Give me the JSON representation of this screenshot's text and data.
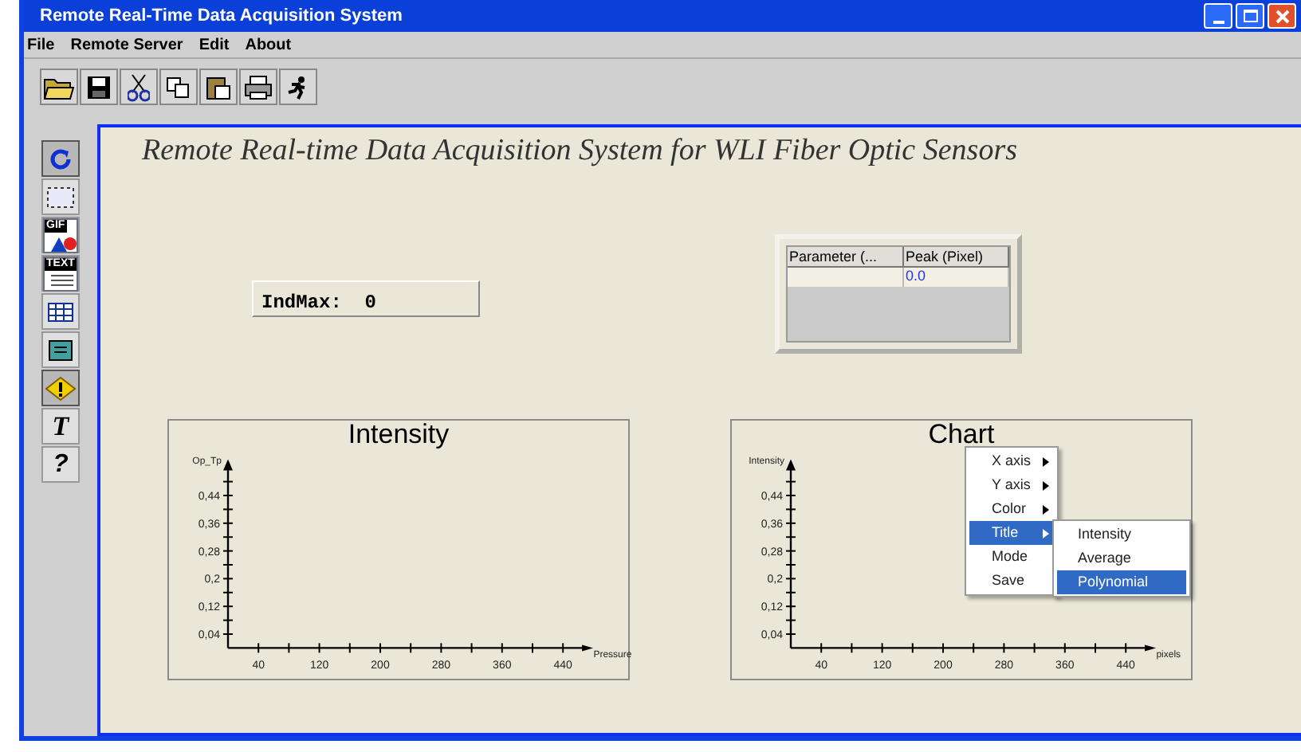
{
  "window": {
    "title": "Remote Real-Time Data Acquisition System"
  },
  "menu": [
    "File",
    "Remote Server",
    "Edit",
    "About"
  ],
  "toolbar": [
    {
      "kind": "open"
    },
    {
      "kind": "save"
    },
    {
      "kind": "cut"
    },
    {
      "kind": "copy"
    },
    {
      "kind": "paste"
    },
    {
      "kind": "print"
    },
    {
      "kind": "run"
    }
  ],
  "tools": [
    {
      "kind": "refresh",
      "selected": true
    },
    {
      "kind": "select",
      "selected": false
    },
    {
      "kind": "gif",
      "label": "GIF",
      "selected": false
    },
    {
      "kind": "text",
      "label": "TEXT",
      "selected": false
    },
    {
      "kind": "table",
      "selected": false
    },
    {
      "kind": "panel",
      "selected": false
    },
    {
      "kind": "warning",
      "selected": true
    },
    {
      "kind": "font",
      "label": "T",
      "selected": false
    },
    {
      "kind": "help",
      "label": "?",
      "selected": false
    }
  ],
  "heading": "Remote Real-time Data Acquisition System for WLI Fiber Optic Sensors",
  "indmax": "IndMax:  0",
  "table": {
    "columns": [
      "Parameter (...",
      "Peak (Pixel)"
    ],
    "rows": [
      [
        "",
        "0.0"
      ]
    ]
  },
  "charts": [
    {
      "chart_data": {
        "type": "line",
        "title": "Intensity",
        "xlabel": "Pressure",
        "ylabel": "Op_Tp",
        "xlim": [
          0,
          465
        ],
        "ylim": [
          0,
          0.54
        ],
        "xticks": [
          40,
          120,
          200,
          280,
          360,
          440
        ],
        "yticks": [
          {
            "value": 0.04,
            "label": "0,04"
          },
          {
            "value": 0.12,
            "label": "0,12"
          },
          {
            "value": 0.2,
            "label": "0,2"
          },
          {
            "value": 0.28,
            "label": "0,28"
          },
          {
            "value": 0.36,
            "label": "0,36"
          },
          {
            "value": 0.44,
            "label": "0,44"
          }
        ]
      }
    },
    {
      "chart_data": {
        "type": "line",
        "title": "Chart",
        "xlabel": "pixels",
        "ylabel": "Intensity",
        "xlim": [
          0,
          465
        ],
        "ylim": [
          0,
          0.54
        ],
        "xticks": [
          40,
          120,
          200,
          280,
          360,
          440
        ],
        "yticks": [
          {
            "value": 0.04,
            "label": "0,04"
          },
          {
            "value": 0.12,
            "label": "0,12"
          },
          {
            "value": 0.2,
            "label": "0,2"
          },
          {
            "value": 0.28,
            "label": "0,28"
          },
          {
            "value": 0.36,
            "label": "0,36"
          },
          {
            "value": 0.44,
            "label": "0,44"
          }
        ]
      }
    }
  ],
  "context_menu": {
    "items": [
      {
        "label": "X axis",
        "submenu": true,
        "selected": false
      },
      {
        "label": "Y axis",
        "submenu": true,
        "selected": false
      },
      {
        "label": "Color",
        "submenu": true,
        "selected": false
      },
      {
        "label": "Title",
        "submenu": true,
        "selected": true
      },
      {
        "label": "Mode",
        "submenu": false,
        "selected": false
      },
      {
        "label": "Save",
        "submenu": false,
        "selected": false
      }
    ],
    "submenu": [
      {
        "label": "Intensity",
        "selected": false
      },
      {
        "label": "Average",
        "selected": false
      },
      {
        "label": "Polynomial",
        "selected": true
      }
    ]
  }
}
